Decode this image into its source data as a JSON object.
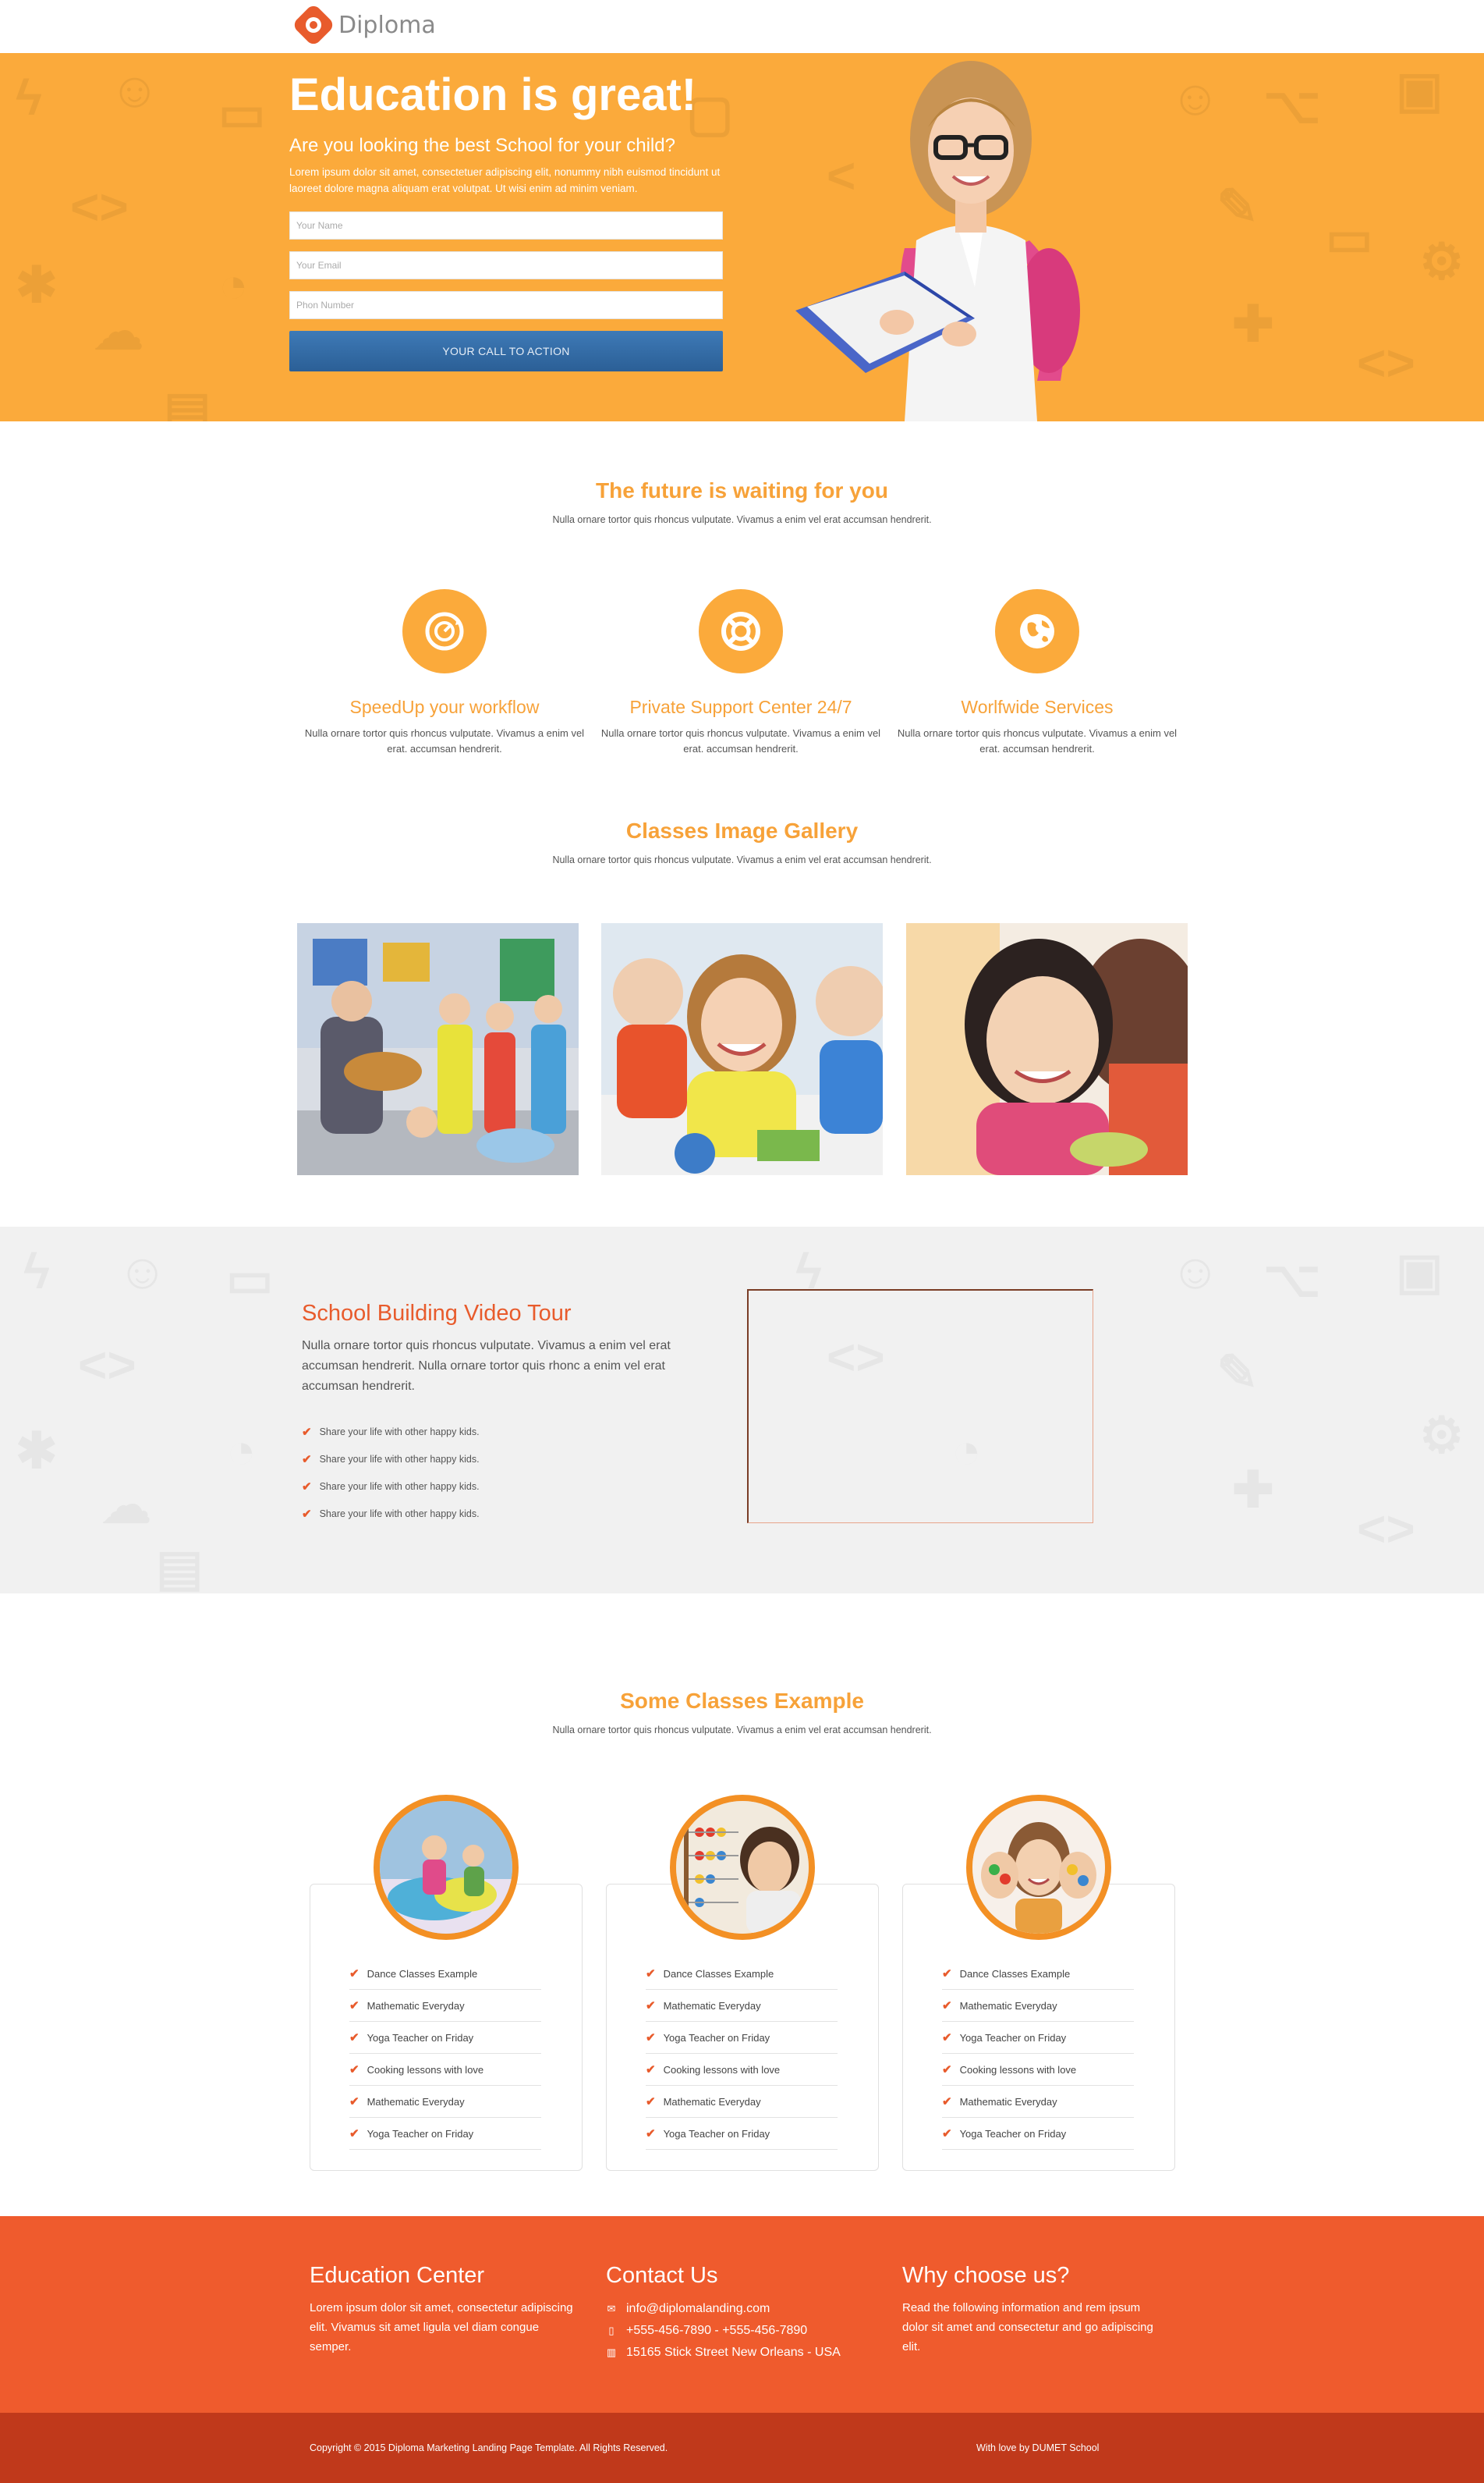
{
  "brand": {
    "name": "Diploma"
  },
  "hero": {
    "title": "Education is great!",
    "subtitle": "Are you looking the best School for your child?",
    "lorem": "Lorem ipsum dolor sit amet, consectetuer adipiscing elit, nonummy nibh euismod tincidunt ut laoreet dolore magna aliquam erat volutpat. Ut wisi enim ad minim veniam.",
    "name_placeholder": "Your Name",
    "email_placeholder": "Your Email",
    "phone_placeholder": "Phon Number",
    "cta_label": "YOUR CALL TO ACTION"
  },
  "future": {
    "title": "The future is waiting for you",
    "subtitle": "Nulla ornare tortor quis rhoncus vulputate. Vivamus a enim vel erat accumsan hendrerit.",
    "features": [
      {
        "icon": "speedometer-icon",
        "title": "SpeedUp your workflow",
        "text": "Nulla ornare tortor quis rhoncus vulputate. Vivamus a enim vel erat. accumsan hendrerit."
      },
      {
        "icon": "lifebuoy-icon",
        "title": "Private Support Center 24/7",
        "text": "Nulla ornare tortor quis rhoncus vulputate. Vivamus a enim vel erat. accumsan hendrerit."
      },
      {
        "icon": "globe-icon",
        "title": "Worlfwide Services",
        "text": "Nulla ornare tortor quis rhoncus vulputate. Vivamus a enim vel erat. accumsan hendrerit."
      }
    ]
  },
  "gallery": {
    "title": "Classes Image Gallery",
    "subtitle": "Nulla ornare tortor quis rhoncus vulputate. Vivamus a enim vel erat accumsan hendrerit."
  },
  "video": {
    "title": "School Building Video Tour",
    "text": "Nulla ornare tortor quis rhoncus vulputate. Vivamus a enim vel erat accumsan hendrerit. Nulla ornare tortor quis rhonc a enim vel erat accumsan hendrerit.",
    "items": [
      "Share your life with other happy kids.",
      "Share your life with other happy kids.",
      "Share your life with other happy kids.",
      "Share your life with other happy kids."
    ]
  },
  "classes": {
    "title": "Some Classes Example",
    "subtitle": "Nulla ornare tortor quis rhoncus vulputate. Vivamus a enim vel erat accumsan hendrerit.",
    "cards": [
      {
        "items": [
          "Dance Classes Example",
          "Mathematic Everyday",
          "Yoga Teacher on Friday",
          "Cooking lessons with love",
          "Mathematic Everyday",
          "Yoga Teacher on Friday"
        ]
      },
      {
        "items": [
          "Dance Classes Example",
          "Mathematic Everyday",
          "Yoga Teacher on Friday",
          "Cooking lessons with love",
          "Mathematic Everyday",
          "Yoga Teacher on Friday"
        ]
      },
      {
        "items": [
          "Dance Classes Example",
          "Mathematic Everyday",
          "Yoga Teacher on Friday",
          "Cooking lessons with love",
          "Mathematic Everyday",
          "Yoga Teacher on Friday"
        ]
      }
    ]
  },
  "footer": {
    "about_title": "Education Center",
    "about_text": "Lorem ipsum dolor sit amet, consectetur adipiscing elit. Vivamus sit amet ligula vel diam congue semper.",
    "contact_title": "Contact Us",
    "email": "info@diplomalanding.com",
    "phone": "+555-456-7890 - +555-456-7890",
    "address": "15165 Stick Street New Orleans - USA",
    "why_title": "Why choose us?",
    "why_text": "Read the following information and rem ipsum dolor sit amet and consectetur and go adipiscing elit.",
    "copyright": "Copyright © 2015 Diploma Marketing Landing Page Template. All Rights Reserved.",
    "made_by": "With love by DUMET School"
  },
  "colors": {
    "orange": "#fbaa3b",
    "accent": "#e85b2c",
    "footer": "#ef5b2d",
    "bottom": "#c0391b",
    "cta": "#2f67a0"
  }
}
